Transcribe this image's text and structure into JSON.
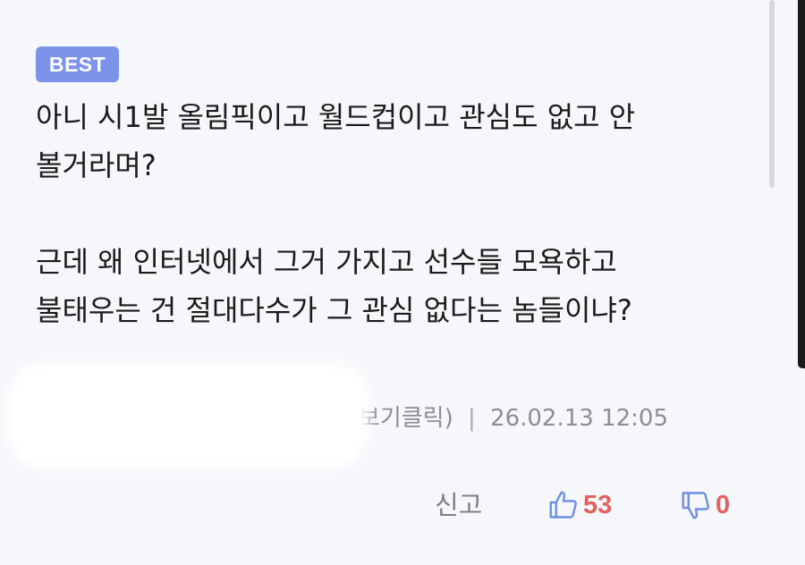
{
  "badge": "BEST",
  "comment": {
    "lines": [
      "아니 시1발 올림픽이고 월드컵이고 관심도 없고 안",
      "볼거라며?",
      "",
      "근데 왜 인터넷에서 그거 가지고 선수들 모욕하고",
      "불태우는 건 절대다수가 그 관심 없다는 놈들이냐?"
    ]
  },
  "meta": {
    "author_fragment": "ıP보기클릭)",
    "separator": "|",
    "timestamp": "26.02.13 12:05"
  },
  "actions": {
    "report_label": "신고",
    "like_count": "53",
    "dislike_count": "0"
  },
  "colors": {
    "badge_bg": "#7b93e8",
    "count_red": "#e1625f",
    "icon_blue": "#6f8fe0",
    "meta_gray": "#8b8e99"
  },
  "icons": {
    "like": "thumbs-up-icon",
    "dislike": "thumbs-down-icon"
  }
}
